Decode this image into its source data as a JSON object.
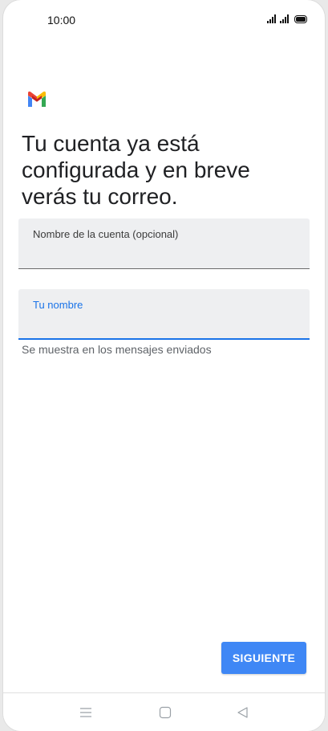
{
  "status_bar": {
    "time": "10:00",
    "icons": [
      "signal-icon",
      "signal-icon",
      "battery-icon"
    ]
  },
  "logo": {
    "name": "gmail-logo",
    "colors": [
      "#4285F4",
      "#EA4335",
      "#FBBC04",
      "#34A853"
    ]
  },
  "heading": "Tu cuenta ya está configurada y en breve verás tu correo.",
  "fields": {
    "account_name": {
      "label": "Nombre de la cuenta (opcional)",
      "value": ""
    },
    "your_name": {
      "label": "Tu nombre",
      "value": "",
      "helper": "Se muestra en los mensajes enviados"
    }
  },
  "actions": {
    "next_label": "SIGUIENTE"
  },
  "navigation": {
    "icons": [
      "menu-icon",
      "home-icon",
      "back-icon"
    ]
  },
  "colors": {
    "accent": "#1a73e8",
    "button": "#3f87f5",
    "field_background": "#eeeff1"
  }
}
